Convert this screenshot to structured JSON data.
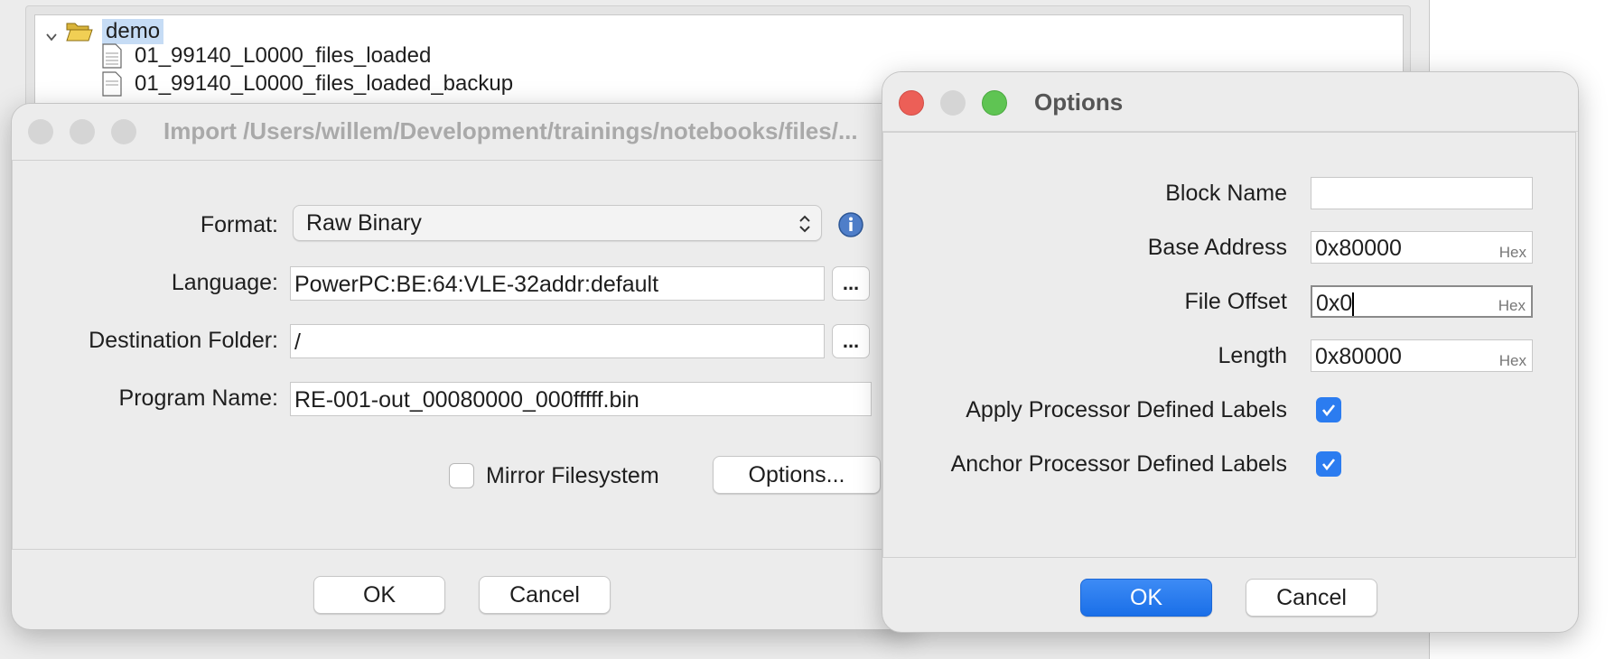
{
  "tree": {
    "root_label": "demo",
    "items": [
      "01_99140_L0000_files_loaded",
      "01_99140_L0000_files_loaded_backup"
    ]
  },
  "import_dialog": {
    "title": "Import /Users/willem/Development/trainings/notebooks/files/...",
    "format_label": "Format:",
    "format_value": "Raw Binary",
    "language_label": "Language:",
    "language_value": "PowerPC:BE:64:VLE-32addr:default",
    "destination_label": "Destination Folder:",
    "destination_value": "/",
    "program_name_label": "Program Name:",
    "program_name_value": "RE-001-out_00080000_000fffff.bin",
    "mirror_label": "Mirror Filesystem",
    "mirror_checked": false,
    "options_button": "Options...",
    "browse_button": "...",
    "ok": "OK",
    "cancel": "Cancel"
  },
  "options_dialog": {
    "title": "Options",
    "block_name_label": "Block Name",
    "block_name_value": "",
    "base_address_label": "Base Address",
    "base_address_value": "0x80000",
    "file_offset_label": "File Offset",
    "file_offset_value": "0x0",
    "length_label": "Length",
    "length_value": "0x80000",
    "hex_hint": "Hex",
    "apply_label": "Apply Processor Defined Labels",
    "apply_checked": true,
    "anchor_label": "Anchor Processor Defined Labels",
    "anchor_checked": true,
    "ok": "OK",
    "cancel": "Cancel"
  },
  "colors": {
    "accent": "#2b7cf0",
    "close": "#ec5f57",
    "minimize": "#d5d5d5",
    "zoom": "#5fc453"
  }
}
